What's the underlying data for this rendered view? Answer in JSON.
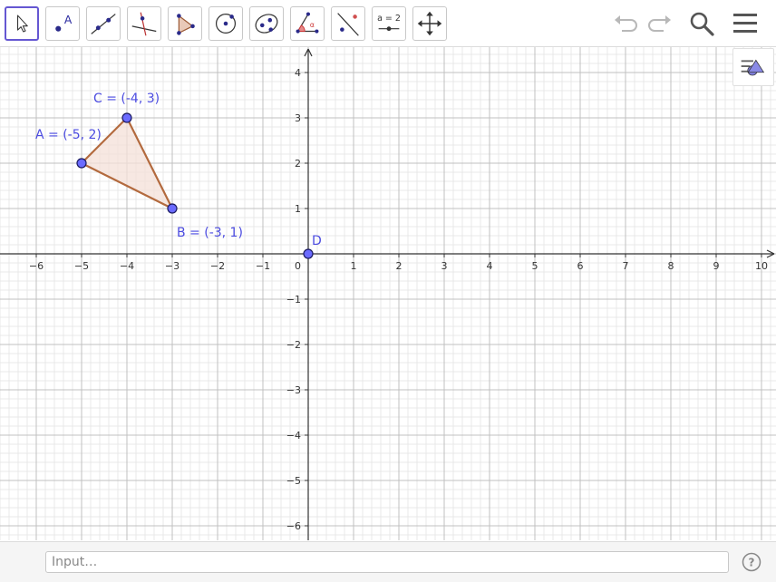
{
  "toolbar": {
    "tools": [
      {
        "name": "move-tool",
        "icon": "arrow-pointer-icon",
        "active": true
      },
      {
        "name": "point-tool",
        "icon": "point-icon",
        "glyph": "A"
      },
      {
        "name": "line-tool",
        "icon": "line-through-points-icon"
      },
      {
        "name": "perpendicular-line-tool",
        "icon": "perpendicular-line-icon"
      },
      {
        "name": "polygon-tool",
        "icon": "polygon-icon"
      },
      {
        "name": "circle-tool",
        "icon": "circle-with-center-icon"
      },
      {
        "name": "ellipse-tool",
        "icon": "ellipse-icon"
      },
      {
        "name": "angle-tool",
        "icon": "angle-icon"
      },
      {
        "name": "reflect-tool",
        "icon": "reflect-about-line-icon"
      },
      {
        "name": "slider-tool",
        "icon": "slider-icon",
        "glyph": "a = 2"
      },
      {
        "name": "move-view-tool",
        "icon": "move-graphics-view-icon"
      }
    ],
    "undo_icon": "undo-icon",
    "redo_icon": "redo-icon",
    "search_icon": "search-icon",
    "menu_icon": "hamburger-menu-icon"
  },
  "graphics": {
    "x_ticks": [
      "−6",
      "−5",
      "−4",
      "−3",
      "−2",
      "−1",
      "1",
      "2",
      "3",
      "4",
      "5",
      "6",
      "7",
      "8",
      "9",
      "10"
    ],
    "y_ticks": [
      "4",
      "3",
      "2",
      "1",
      "−1",
      "−2",
      "−3",
      "−4",
      "−5",
      "−6"
    ],
    "origin_label": "0",
    "points": [
      {
        "id": "A",
        "label": "A = (-5, 2)",
        "x": -5,
        "y": 2
      },
      {
        "id": "B",
        "label": "B = (-3, 1)",
        "x": -3,
        "y": 1
      },
      {
        "id": "C",
        "label": "C = (-4, 3)",
        "x": -4,
        "y": 3
      },
      {
        "id": "D",
        "label": "D",
        "x": 0,
        "y": 0
      }
    ],
    "polygon": [
      "A",
      "B",
      "C"
    ],
    "colors": {
      "point_fill": "#6b6bff",
      "point_stroke": "#1a1a60",
      "label": "#4b4be0",
      "polygon_stroke": "#b36a3e",
      "polygon_fill": "#f4e0d8",
      "grid_major": "#c0c0c0",
      "grid_minor": "#e8e8e8",
      "axis": "#333333",
      "accent": "#6557d2"
    }
  },
  "style_bar": {
    "icon": "graphics-style-bar-icon"
  },
  "input_bar": {
    "placeholder": "Input…",
    "help_icon": "help-icon"
  }
}
